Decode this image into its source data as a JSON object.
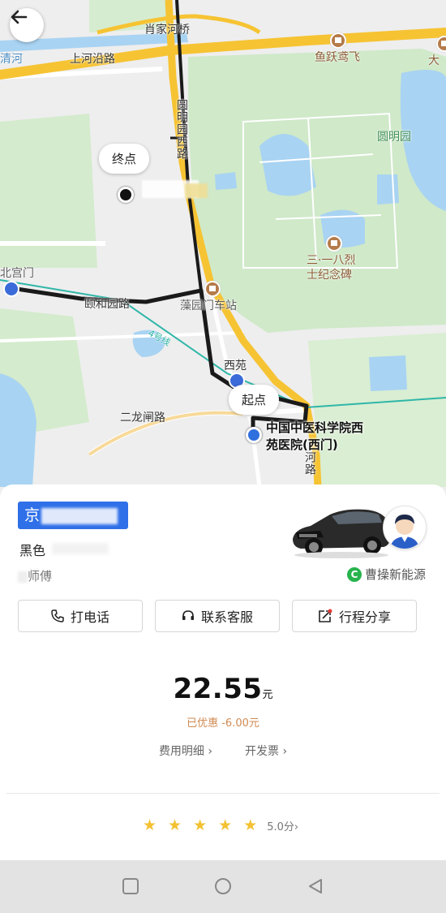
{
  "map": {
    "labels": {
      "xiaojia_bridge": "肖家河桥",
      "shanghe_road": "上河沿路",
      "qing_he": "清河",
      "yuyue_yuanfei": "鱼跃鸢飞",
      "da": "大",
      "yuanmingyuan": "圆明园",
      "yuanmingyuan_west_road": "圆明园西路",
      "memorial_line1": "三·一八烈",
      "memorial_line2": "士纪念碑",
      "beigongmen": "北宫门",
      "yiheyuan_road": "颐和园路",
      "zaoyuan_depot": "藻园门车站",
      "line4": "4号线",
      "xiyuan": "西苑",
      "erlongzha_road": "二龙闸路",
      "river_road": "河路"
    },
    "end_bubble": "终点",
    "start_bubble": "起点",
    "start_location": {
      "line1": "中国中医科学院西",
      "line2": "苑医院(西门)"
    },
    "route_color": "#1a1a1a",
    "highway_color": "#f6c333",
    "subway_color": "#2fb6a8"
  },
  "driver": {
    "plate_prefix": "京",
    "car_color": "黑色",
    "name_suffix": "师傅",
    "service_brand": "曹操新能源",
    "brand_logo_letter": "C"
  },
  "actions": {
    "call": "打电话",
    "support": "联系客服",
    "share": "行程分享"
  },
  "fare": {
    "amount": "22.55",
    "unit": "元",
    "discount": "已优惠  -6.00元",
    "detail_link": "费用明细",
    "invoice_link": "开发票"
  },
  "rating": {
    "stars": 5,
    "score": "5.0分"
  },
  "colors": {
    "plate_blue": "#2f6fe8",
    "star_gold": "#f3c132",
    "discount_orange": "#d08a52"
  }
}
